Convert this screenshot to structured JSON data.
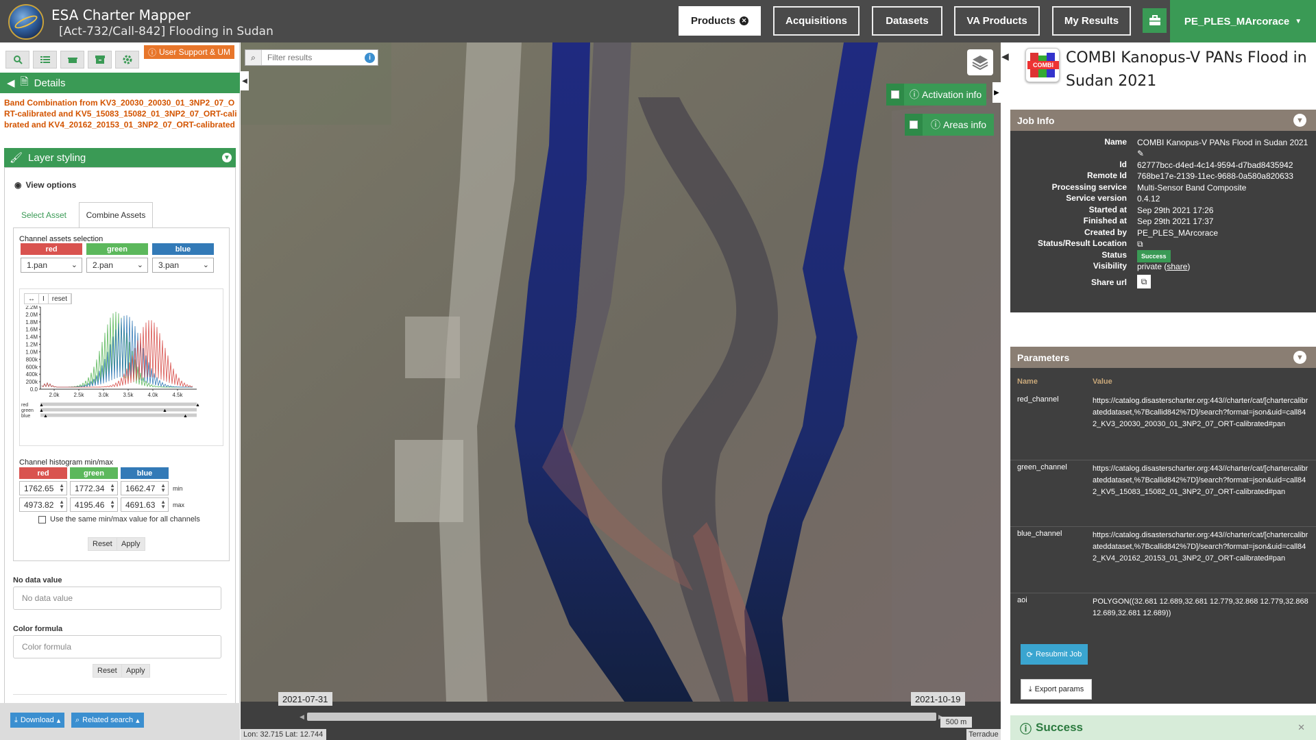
{
  "header": {
    "app_title": "ESA Charter Mapper",
    "subtitle": "[Act-732/Call-842] Flooding in Sudan",
    "nav": [
      "Products",
      "Acquisitions",
      "Datasets",
      "VA Products",
      "My Results"
    ],
    "user": "PE_PLES_MArcorace"
  },
  "left": {
    "support_label": "User Support & UM",
    "details_label": "Details",
    "band_description": "Band Combination from KV3_20030_20030_01_3NP2_07_ORT-calibrated and KV5_15083_15082_01_3NP2_07_ORT-calibrated and KV4_20162_20153_01_3NP2_07_ORT-calibrated",
    "layer_styling_label": "Layer styling",
    "view_options_label": "View options",
    "tab_select": "Select Asset",
    "tab_combine": "Combine Assets",
    "channel_assets_label": "Channel assets selection",
    "channels": [
      {
        "name": "red",
        "color": "#d9534f",
        "asset": "1.pan",
        "min": "1762.65",
        "max": "4973.82"
      },
      {
        "name": "green",
        "color": "#5cb85c",
        "asset": "2.pan",
        "min": "1772.34",
        "max": "4195.46"
      },
      {
        "name": "blue",
        "color": "#337ab7",
        "asset": "3.pan",
        "min": "1662.47",
        "max": "4691.63"
      }
    ],
    "hist_tools": [
      "↔",
      "I",
      "reset"
    ],
    "hist_y_ticks": [
      "2.2M",
      "2.0M",
      "1.8M",
      "1.6M",
      "1.4M",
      "1.2M",
      "1.0M",
      "800k",
      "600k",
      "400k",
      "200k",
      "0.0"
    ],
    "hist_x_ticks": [
      "2.0k",
      "2.5k",
      "3.0k",
      "3.5k",
      "4.0k",
      "4.5k"
    ],
    "slider_labels": [
      "red",
      "green",
      "blue"
    ],
    "minmax_label": "Channel histogram min/max",
    "min_label": "min",
    "max_label": "max",
    "same_minmax_label": "Use the same min/max value for all channels",
    "reset_label": "Reset",
    "apply_label": "Apply",
    "no_data_label": "No data value",
    "no_data_placeholder": "No data value",
    "color_formula_label": "Color formula",
    "color_formula_placeholder": "Color formula",
    "download_label": "Download",
    "related_label": "Related search"
  },
  "map": {
    "filter_placeholder": "Filter results",
    "activation_info": "Activation info",
    "areas_info": "Areas info",
    "date_start": "2021-07-31",
    "date_end": "2021-10-19",
    "scale": "500 m",
    "coords": "Lon: 32.715 Lat: 12.744",
    "attribution": "Terradue"
  },
  "right": {
    "icon_label": "COMBI",
    "title": "COMBI Kanopus-V PANs Flood in Sudan 2021",
    "job_info_label": "Job Info",
    "job_info": [
      {
        "key": "Name",
        "value": "COMBI Kanopus-V PANs Flood in Sudan 2021"
      },
      {
        "key": "Id",
        "value": "62777bcc-d4ed-4c14-9594-d7bad8435942"
      },
      {
        "key": "Remote Id",
        "value": "768be17e-2139-11ec-9688-0a580a820633"
      },
      {
        "key": "Processing service",
        "value": "Multi-Sensor Band Composite"
      },
      {
        "key": "Service version",
        "value": "0.4.12"
      },
      {
        "key": "Started at",
        "value": "Sep 29th 2021 17:26"
      },
      {
        "key": "Finished at",
        "value": "Sep 29th 2021 17:37"
      },
      {
        "key": "Created by",
        "value": "PE_PLES_MArcorace"
      },
      {
        "key": "Status/Result Location",
        "value": ""
      },
      {
        "key": "Status",
        "value": "Success"
      },
      {
        "key": "Visibility",
        "value": "private"
      },
      {
        "key": "Share url",
        "value": ""
      }
    ],
    "share_link": "share",
    "parameters_label": "Parameters",
    "param_col_name": "Name",
    "param_col_value": "Value",
    "parameters": [
      {
        "name": "red_channel",
        "value": "https://catalog.disasterscharter.org:443//charter/cat/[chartercalibrateddataset,%7Bcallid842%7D]/search?format=json&uid=call842_KV3_20030_20030_01_3NP2_07_ORT-calibrated#pan"
      },
      {
        "name": "green_channel",
        "value": "https://catalog.disasterscharter.org:443//charter/cat/[chartercalibrateddataset,%7Bcallid842%7D]/search?format=json&uid=call842_KV5_15083_15082_01_3NP2_07_ORT-calibrated#pan"
      },
      {
        "name": "blue_channel",
        "value": "https://catalog.disasterscharter.org:443//charter/cat/[chartercalibrateddataset,%7Bcallid842%7D]/search?format=json&uid=call842_KV4_20162_20153_01_3NP2_07_ORT-calibrated#pan"
      },
      {
        "name": "aoi",
        "value": "POLYGON((32.681 12.689,32.681 12.779,32.868 12.779,32.868 12.689,32.681 12.689))"
      }
    ],
    "resubmit_label": "Resubmit Job",
    "export_label": "Export params",
    "success_label": "Success"
  }
}
